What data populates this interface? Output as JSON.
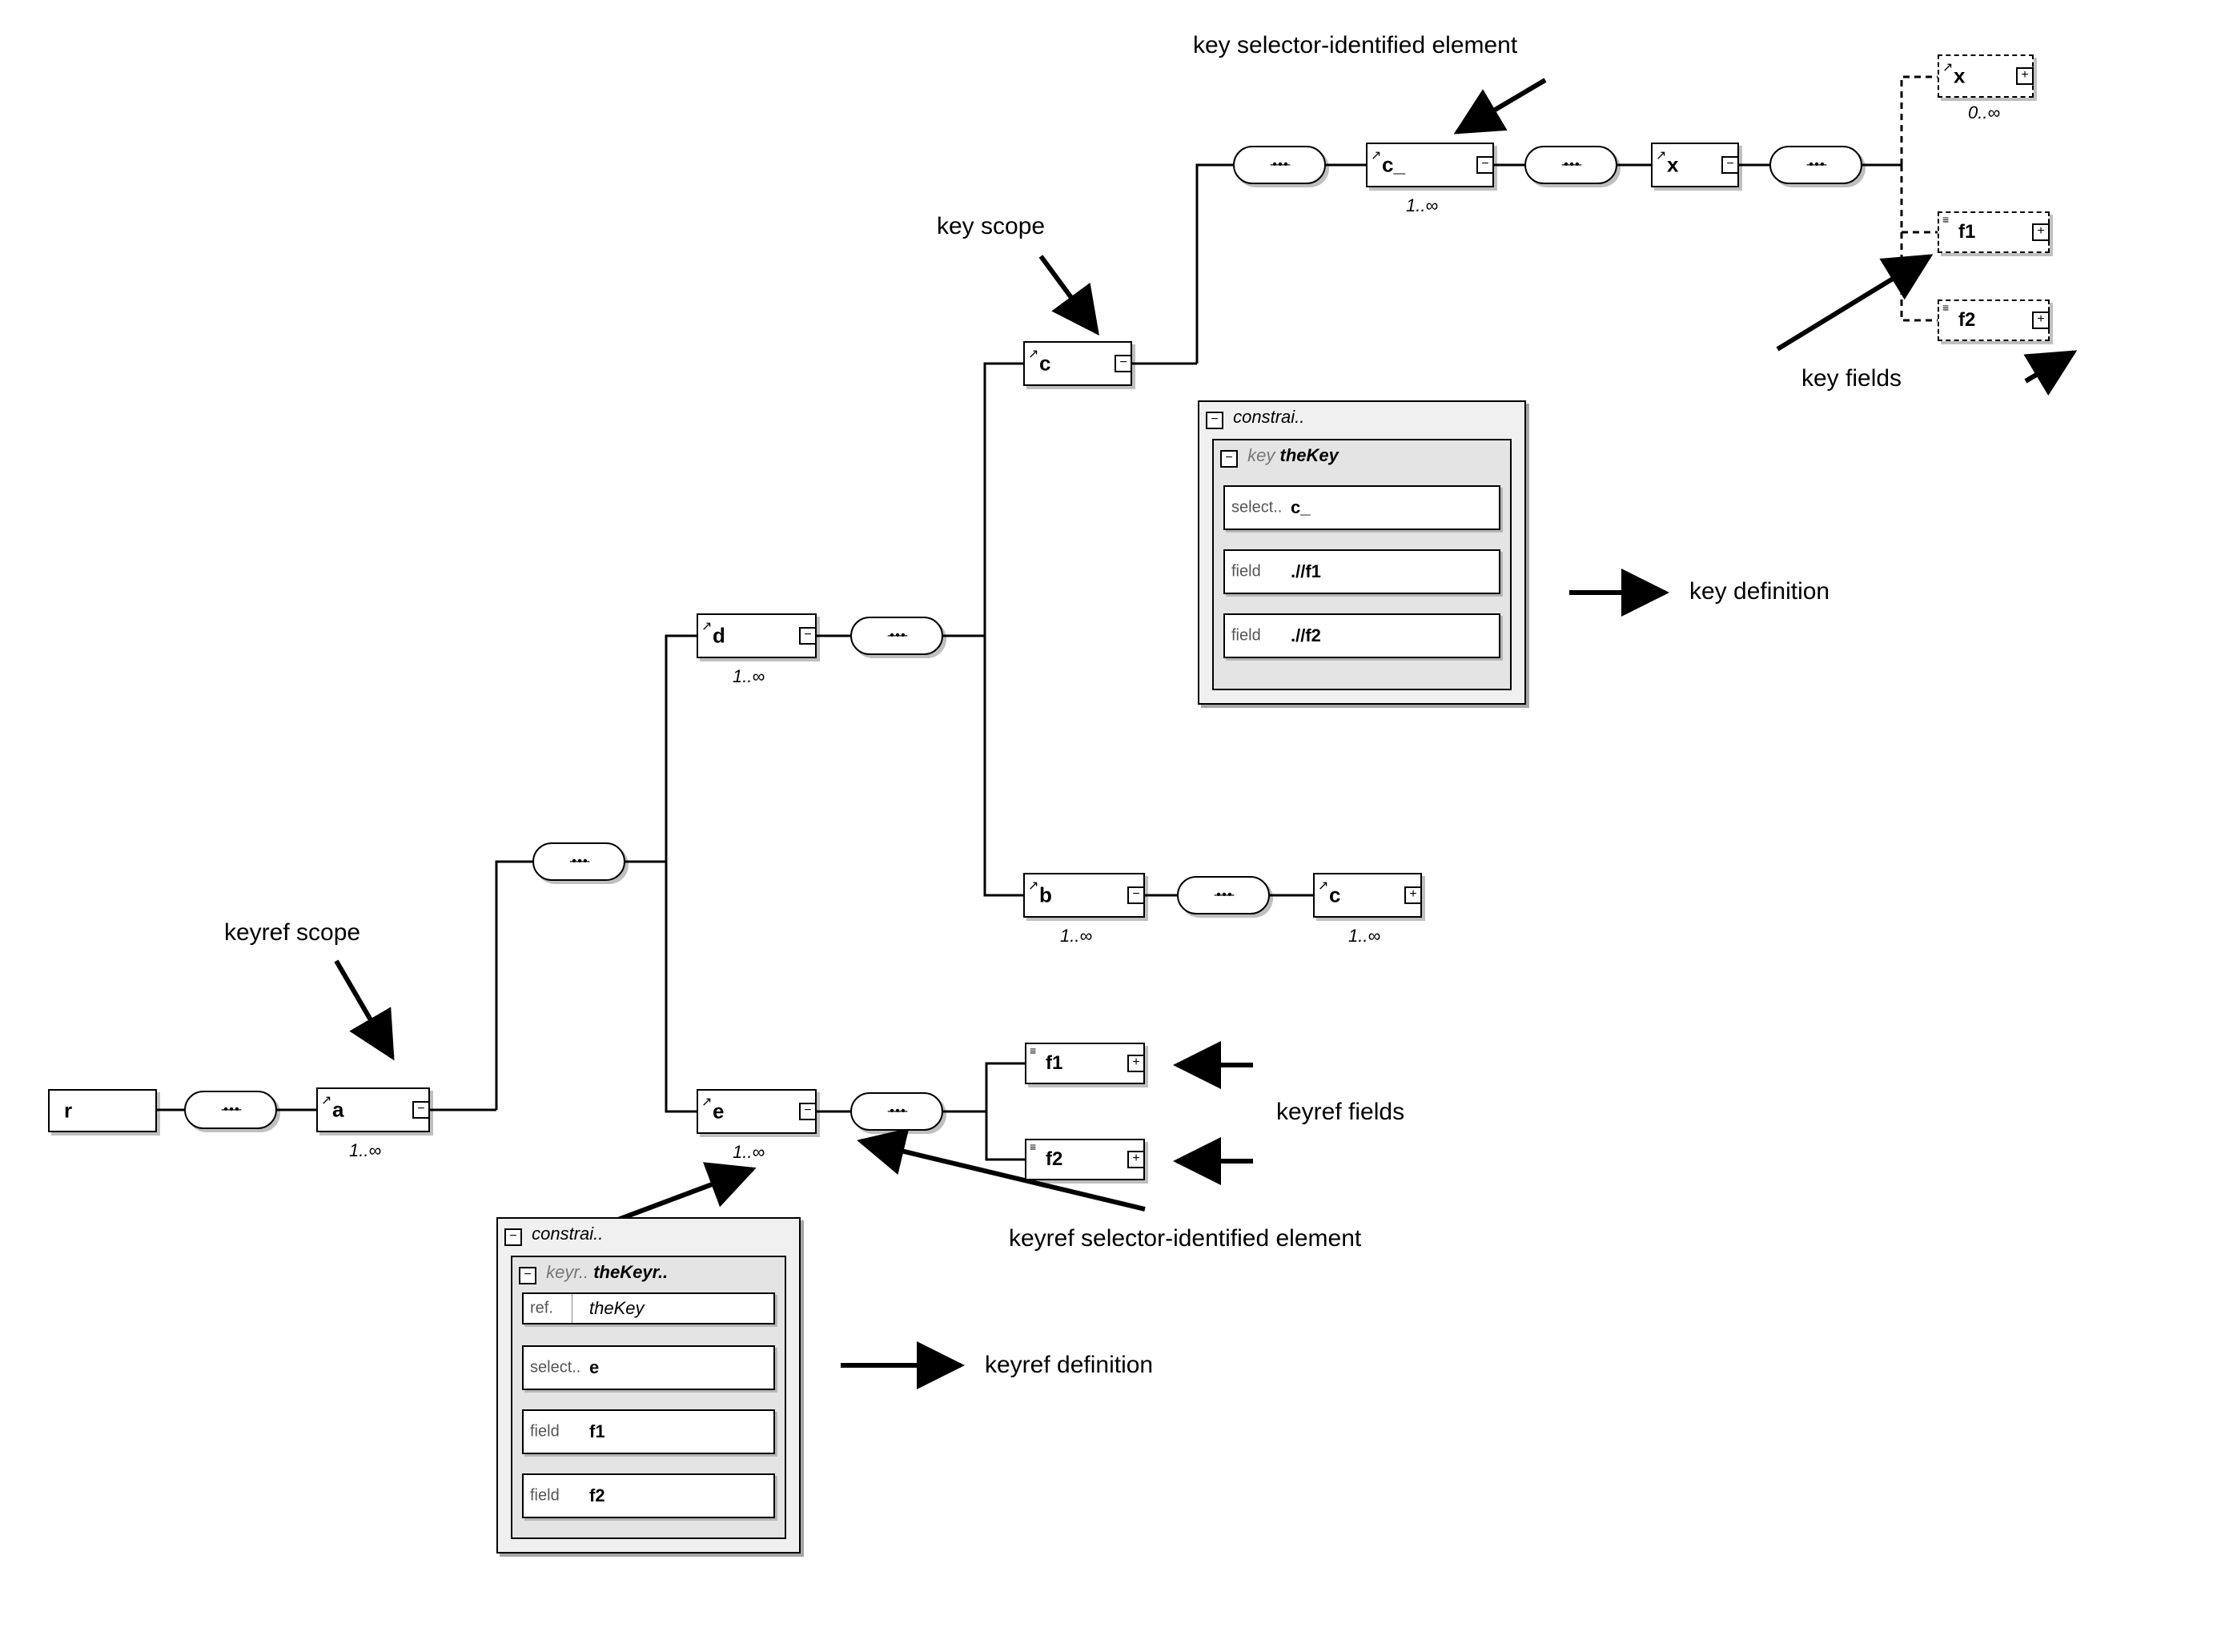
{
  "diagram": {
    "elements": {
      "r": "r",
      "a": "a",
      "d": "d",
      "e": "e",
      "b": "b",
      "c_scope": "c",
      "c_ref": "c",
      "c_selector": "c_",
      "x": "x",
      "x_opt": "x"
    },
    "occurs": {
      "a": "1..∞",
      "d": "1..∞",
      "e": "1..∞",
      "b": "1..∞",
      "c_ref": "1..∞",
      "c_selector": "1..∞",
      "x_opt": "0..∞"
    },
    "key_fields": {
      "f1": "f1",
      "f2": "f2"
    },
    "keyref_fields": {
      "f1": "f1",
      "f2": "f2"
    }
  },
  "keyref_constraint": {
    "panel_title": "constrai..",
    "type_label": "keyr..",
    "name": "theKeyr..",
    "refer_label": "ref.",
    "refer_value": "theKey",
    "rows": {
      "selector_label": "select..",
      "selector_value": "e",
      "field1_label": "field",
      "field1_value": "f1",
      "field2_label": "field",
      "field2_value": "f2"
    }
  },
  "key_constraint": {
    "panel_title": "constrai..",
    "type_label": "key",
    "name": "theKey",
    "rows": {
      "selector_label": "select..",
      "selector_value": "c_",
      "field1_label": "field",
      "field1_value": ".//f1",
      "field2_label": "field",
      "field2_value": ".//f2"
    }
  },
  "annotations": {
    "keyref_scope": "keyref scope",
    "keyref_definition": "keyref definition",
    "keyref_selector": "keyref selector-identified element",
    "keyref_fields": "keyref fields",
    "key_scope": "key scope",
    "key_definition": "key definition",
    "key_selector": "key selector-identified element",
    "key_fields": "key fields"
  },
  "glyphs": {
    "ref_arrow": "↗",
    "plus": "+",
    "minus": "−",
    "bars": "≡",
    "seq_dots": "-•-•-•-"
  }
}
